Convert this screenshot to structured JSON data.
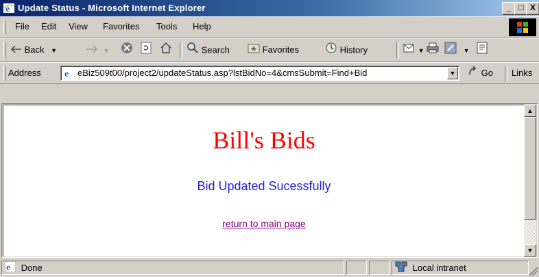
{
  "window": {
    "title": "Update Status - Microsoft Internet Explorer",
    "minimize": "_",
    "maximize": "□",
    "close": "X"
  },
  "menu": [
    "File",
    "Edit",
    "View",
    "Favorites",
    "Tools",
    "Help"
  ],
  "toolbar": {
    "back": "Back",
    "search": "Search",
    "favorites": "Favorites",
    "history": "History"
  },
  "address": {
    "label": "Address",
    "url": "eBiz509t00/project2/updateStatus.asp?lstBidNo=4&cmsSubmit=Find+Bid",
    "go": "Go",
    "links": "Links"
  },
  "page": {
    "heading": "Bill's Bids",
    "message": "Bid Updated Sucessfully",
    "link": "return to main page"
  },
  "status": {
    "text": "Done",
    "zone": "Local intranet"
  },
  "colors": {
    "heading": "#ff0000",
    "message": "#1f1fdf",
    "visited_link": "#800080",
    "title_bar": "#0a246a"
  }
}
